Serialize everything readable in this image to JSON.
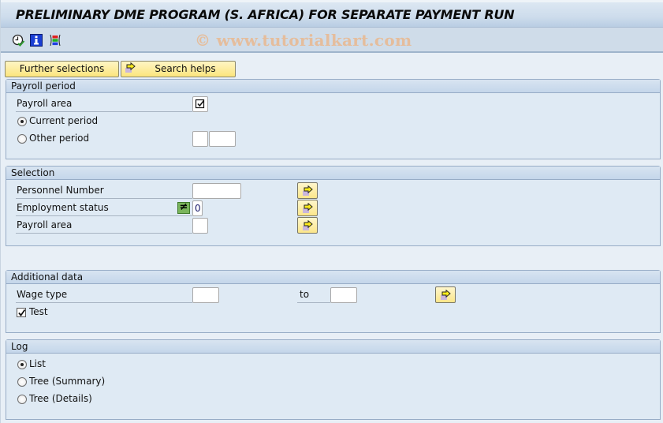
{
  "window": {
    "title": "PRELIMINARY DME PROGRAM (S. AFRICA) FOR SEPARATE PAYMENT RUN",
    "watermark": "© www.tutorialkart.com"
  },
  "toolbar": {
    "icons": [
      "execute-clock-icon",
      "info-icon",
      "selection-screen-variant-icon"
    ]
  },
  "buttons": {
    "further_selections": "Further selections",
    "search_helps": "Search helps"
  },
  "payroll_period": {
    "title": "Payroll period",
    "payroll_area_label": "Payroll area",
    "payroll_area_checked": true,
    "current_period_label": "Current period",
    "current_period_selected": true,
    "other_period_label": "Other period",
    "other_period_selected": false,
    "other_period_value1": "",
    "other_period_value2": ""
  },
  "selection": {
    "title": "Selection",
    "rows": [
      {
        "label": "Personnel Number",
        "value": ""
      },
      {
        "label": "Employment status",
        "operator": "≠",
        "value": "0"
      },
      {
        "label": "Payroll area",
        "value": ""
      }
    ]
  },
  "additional_data": {
    "title": "Additional data",
    "wage_type_label": "Wage type",
    "wage_type_from": "",
    "to_label": "to",
    "wage_type_to": "",
    "test_label": "Test",
    "test_checked": true
  },
  "log": {
    "title": "Log",
    "options": [
      {
        "label": "List",
        "selected": true
      },
      {
        "label": "Tree (Summary)",
        "selected": false
      },
      {
        "label": "Tree (Details)",
        "selected": false
      }
    ]
  }
}
